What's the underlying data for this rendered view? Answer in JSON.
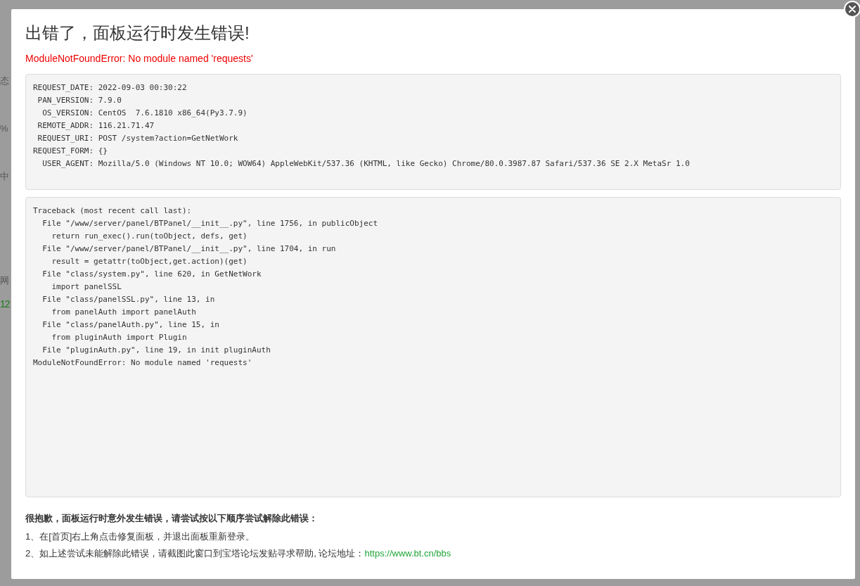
{
  "background": {
    "fragments": [
      {
        "text": "态",
        "kind": "label"
      },
      {
        "text": "%",
        "kind": "label"
      },
      {
        "text": "中",
        "kind": "label"
      },
      {
        "text": "网",
        "kind": "label"
      },
      {
        "text": "12",
        "kind": "number"
      }
    ]
  },
  "dialog": {
    "title": "出错了，面板运行时发生错误!",
    "error": "ModuleNotFoundError: No module named 'requests'",
    "request_info": [
      "REQUEST_DATE: 2022-09-03 00:30:22",
      " PAN_VERSION: 7.9.0",
      "  OS_VERSION: CentOS  7.6.1810 x86_64(Py3.7.9)",
      " REMOTE_ADDR: 116.21.71.47",
      " REQUEST_URI: POST /system?action=GetNetWork",
      "REQUEST_FORM: {}",
      "  USER_AGENT: Mozilla/5.0 (Windows NT 10.0; WOW64) AppleWebKit/537.36 (KHTML, like Gecko) Chrome/80.0.3987.87 Safari/537.36 SE 2.X MetaSr 1.0"
    ],
    "traceback": [
      "Traceback (most recent call last):",
      "  File \"/www/server/panel/BTPanel/__init__.py\", line 1756, in publicObject",
      "    return run_exec().run(toObject, defs, get)",
      "  File \"/www/server/panel/BTPanel/__init__.py\", line 1704, in run",
      "    result = getattr(toObject,get.action)(get)",
      "  File \"class/system.py\", line 620, in GetNetWork",
      "    import panelSSL",
      "  File \"class/panelSSL.py\", line 13, in",
      "    from panelAuth import panelAuth",
      "  File \"class/panelAuth.py\", line 15, in",
      "    from pluginAuth import Plugin",
      "  File \"pluginAuth.py\", line 19, in init pluginAuth",
      "ModuleNotFoundError: No module named 'requests'"
    ],
    "help": {
      "heading": "很抱歉，面板运行时意外发生错误，请尝试按以下顺序尝试解除此错误：",
      "steps": [
        {
          "text": "1、在[首页]右上角点击修复面板，并退出面板重新登录。"
        },
        {
          "text": "2、如上述尝试未能解除此错误，请截图此窗口到宝塔论坛发贴寻求帮助, 论坛地址：",
          "link": "https://www.bt.cn/bbs"
        }
      ]
    }
  }
}
